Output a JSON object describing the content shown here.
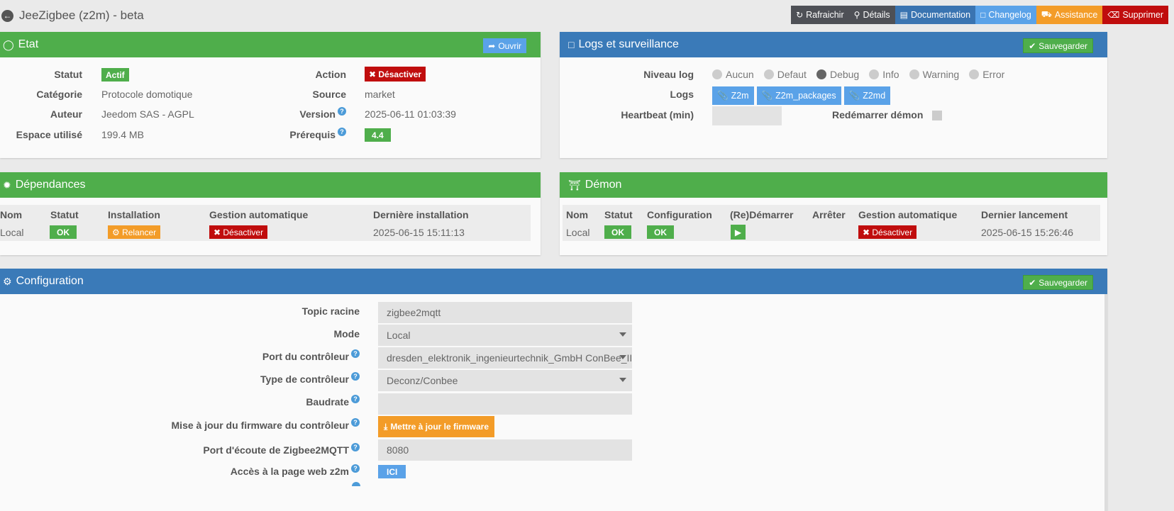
{
  "app": {
    "title": "JeeZigbee (z2m) - beta"
  },
  "toolbar": {
    "refresh": "Rafraichir",
    "details": "Détails",
    "documentation": "Documentation",
    "changelog": "Changelog",
    "assistance": "Assistance",
    "delete": "Supprimer"
  },
  "etat": {
    "title": "Etat",
    "open_btn": "Ouvrir",
    "statut_label": "Statut",
    "statut_value": "Actif",
    "categorie_label": "Catégorie",
    "categorie_value": "Protocole domotique",
    "auteur_label": "Auteur",
    "auteur_value": "Jeedom SAS - AGPL",
    "espace_label": "Espace utilisé",
    "espace_value": "199.4 MB",
    "action_label": "Action",
    "action_value": "Désactiver",
    "source_label": "Source",
    "source_value": "market",
    "version_label": "Version",
    "version_value": "2025-06-11 01:03:39",
    "prerequis_label": "Prérequis",
    "prerequis_value": "4.4"
  },
  "logs": {
    "title": "Logs et surveillance",
    "save_btn": "Sauvegarder",
    "niveau_label": "Niveau log",
    "levels": [
      "Aucun",
      "Defaut",
      "Debug",
      "Info",
      "Warning",
      "Error"
    ],
    "selected_level": "Debug",
    "logs_label": "Logs",
    "log_buttons": [
      "Z2m",
      "Z2m_packages",
      "Z2md"
    ],
    "heartbeat_label": "Heartbeat (min)",
    "heartbeat_value": "",
    "restart_label": "Redémarrer démon"
  },
  "deps": {
    "title": "Dépendances",
    "headers": [
      "Nom",
      "Statut",
      "Installation",
      "Gestion automatique",
      "Dernière installation"
    ],
    "row": {
      "nom": "Local",
      "statut": "OK",
      "installation": "Relancer",
      "gestion": "Désactiver",
      "derniere": "2025-06-15 15:11:13"
    }
  },
  "demon": {
    "title": "Démon",
    "headers": [
      "Nom",
      "Statut",
      "Configuration",
      "(Re)Démarrer",
      "Arrêter",
      "Gestion automatique",
      "Dernier lancement"
    ],
    "row": {
      "nom": "Local",
      "statut": "OK",
      "configuration": "OK",
      "gestion": "Désactiver",
      "dernier": "2025-06-15 15:26:46"
    }
  },
  "config": {
    "title": "Configuration",
    "save_btn": "Sauvegarder",
    "topic_label": "Topic racine",
    "topic_value": "zigbee2mqtt",
    "mode_label": "Mode",
    "mode_value": "Local",
    "port_label": "Port du contrôleur",
    "port_value": "dresden_elektronik_ingenieurtechnik_GmbH ConBee_II",
    "type_label": "Type de contrôleur",
    "type_value": "Deconz/Conbee",
    "baud_label": "Baudrate",
    "baud_value": "",
    "fw_label": "Mise à jour du firmware du contrôleur",
    "fw_btn": "Mettre à jour le firmware",
    "listen_label": "Port d'écoute de Zigbee2MQTT",
    "listen_value": "8080",
    "web_label": "Accès à la page web z2m",
    "web_btn": "ICI"
  },
  "colors": {
    "green": "#4fae4b",
    "blue": "#3a7ab8",
    "red": "#c00d0d",
    "orange": "#f39c28",
    "light_blue": "#5aa2e8"
  }
}
